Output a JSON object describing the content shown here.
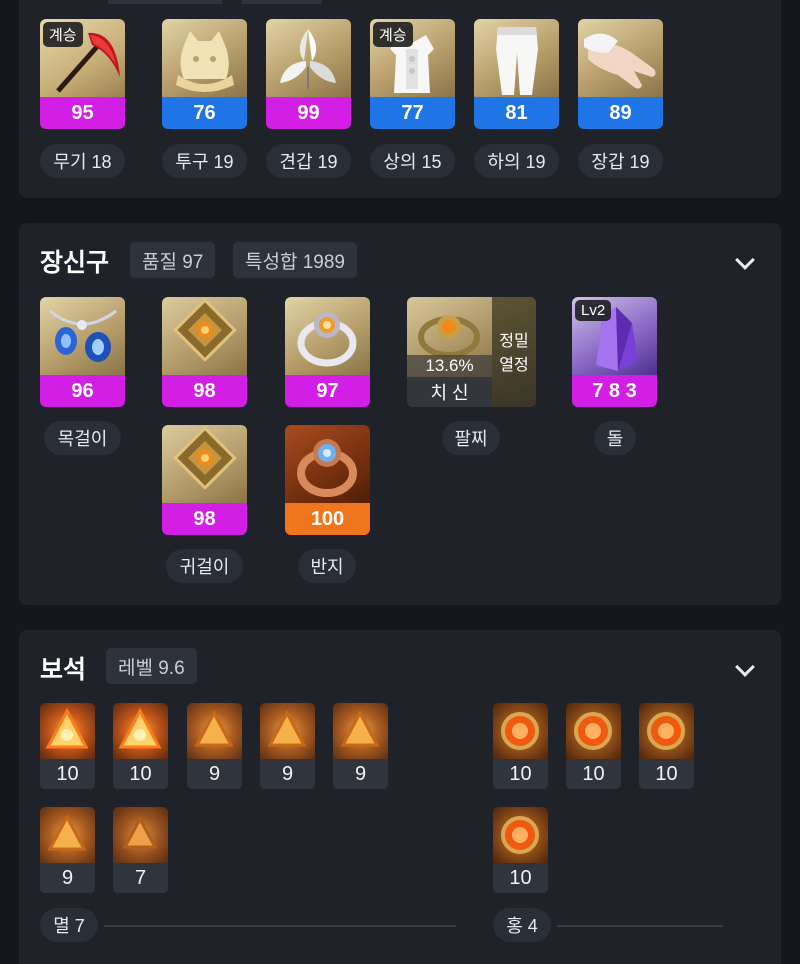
{
  "equipment": {
    "items": [
      {
        "label": "무기 18",
        "quality": "95",
        "badge": "계승",
        "icon": "weapon-scythe-icon"
      },
      {
        "label": "투구 19",
        "quality": "76",
        "badge": "",
        "icon": "helmet-icon"
      },
      {
        "label": "견갑 19",
        "quality": "99",
        "badge": "",
        "icon": "shoulder-icon"
      },
      {
        "label": "상의 15",
        "quality": "77",
        "badge": "계승",
        "icon": "top-armor-icon"
      },
      {
        "label": "하의 19",
        "quality": "81",
        "badge": "",
        "icon": "pants-icon"
      },
      {
        "label": "장갑 19",
        "quality": "89",
        "badge": "",
        "icon": "gloves-icon"
      }
    ]
  },
  "accessories": {
    "title": "장신구",
    "quality_chip": "품질 97",
    "stat_chip": "특성합 1989",
    "necklace": {
      "quality": "96",
      "label": "목걸이",
      "icon": "necklace-icon"
    },
    "earring1": {
      "quality": "98",
      "icon": "earring-icon"
    },
    "ring1": {
      "quality": "97",
      "icon": "ring-icon"
    },
    "earring2": {
      "quality": "98",
      "label": "귀걸이",
      "icon": "earring-icon"
    },
    "ring2": {
      "quality": "100",
      "label": "반지",
      "icon": "ring-icon"
    },
    "bracelet": {
      "percent": "13.6%",
      "stats": "치 신",
      "side_text_1": "정밀",
      "side_text_2": "열정",
      "label": "팔찌",
      "icon": "bracelet-icon"
    },
    "stone": {
      "level": "Lv2",
      "value": "7 8 3",
      "label": "돌",
      "icon": "ability-stone-icon"
    }
  },
  "gems": {
    "title": "보석",
    "level_chip": "레벨 9.6",
    "left_row1": [
      "10",
      "10",
      "9",
      "9",
      "9"
    ],
    "left_row2": [
      "9",
      "7"
    ],
    "right_row1": [
      "10",
      "10",
      "10"
    ],
    "right_row2": [
      "10"
    ],
    "left_label": "멸 7",
    "right_label": "홍 4"
  },
  "colors": {
    "quality_magenta": "#d31ee6",
    "quality_blue": "#1f74e6",
    "quality_orange": "#f0751d",
    "card_bg": "#1f2229"
  }
}
